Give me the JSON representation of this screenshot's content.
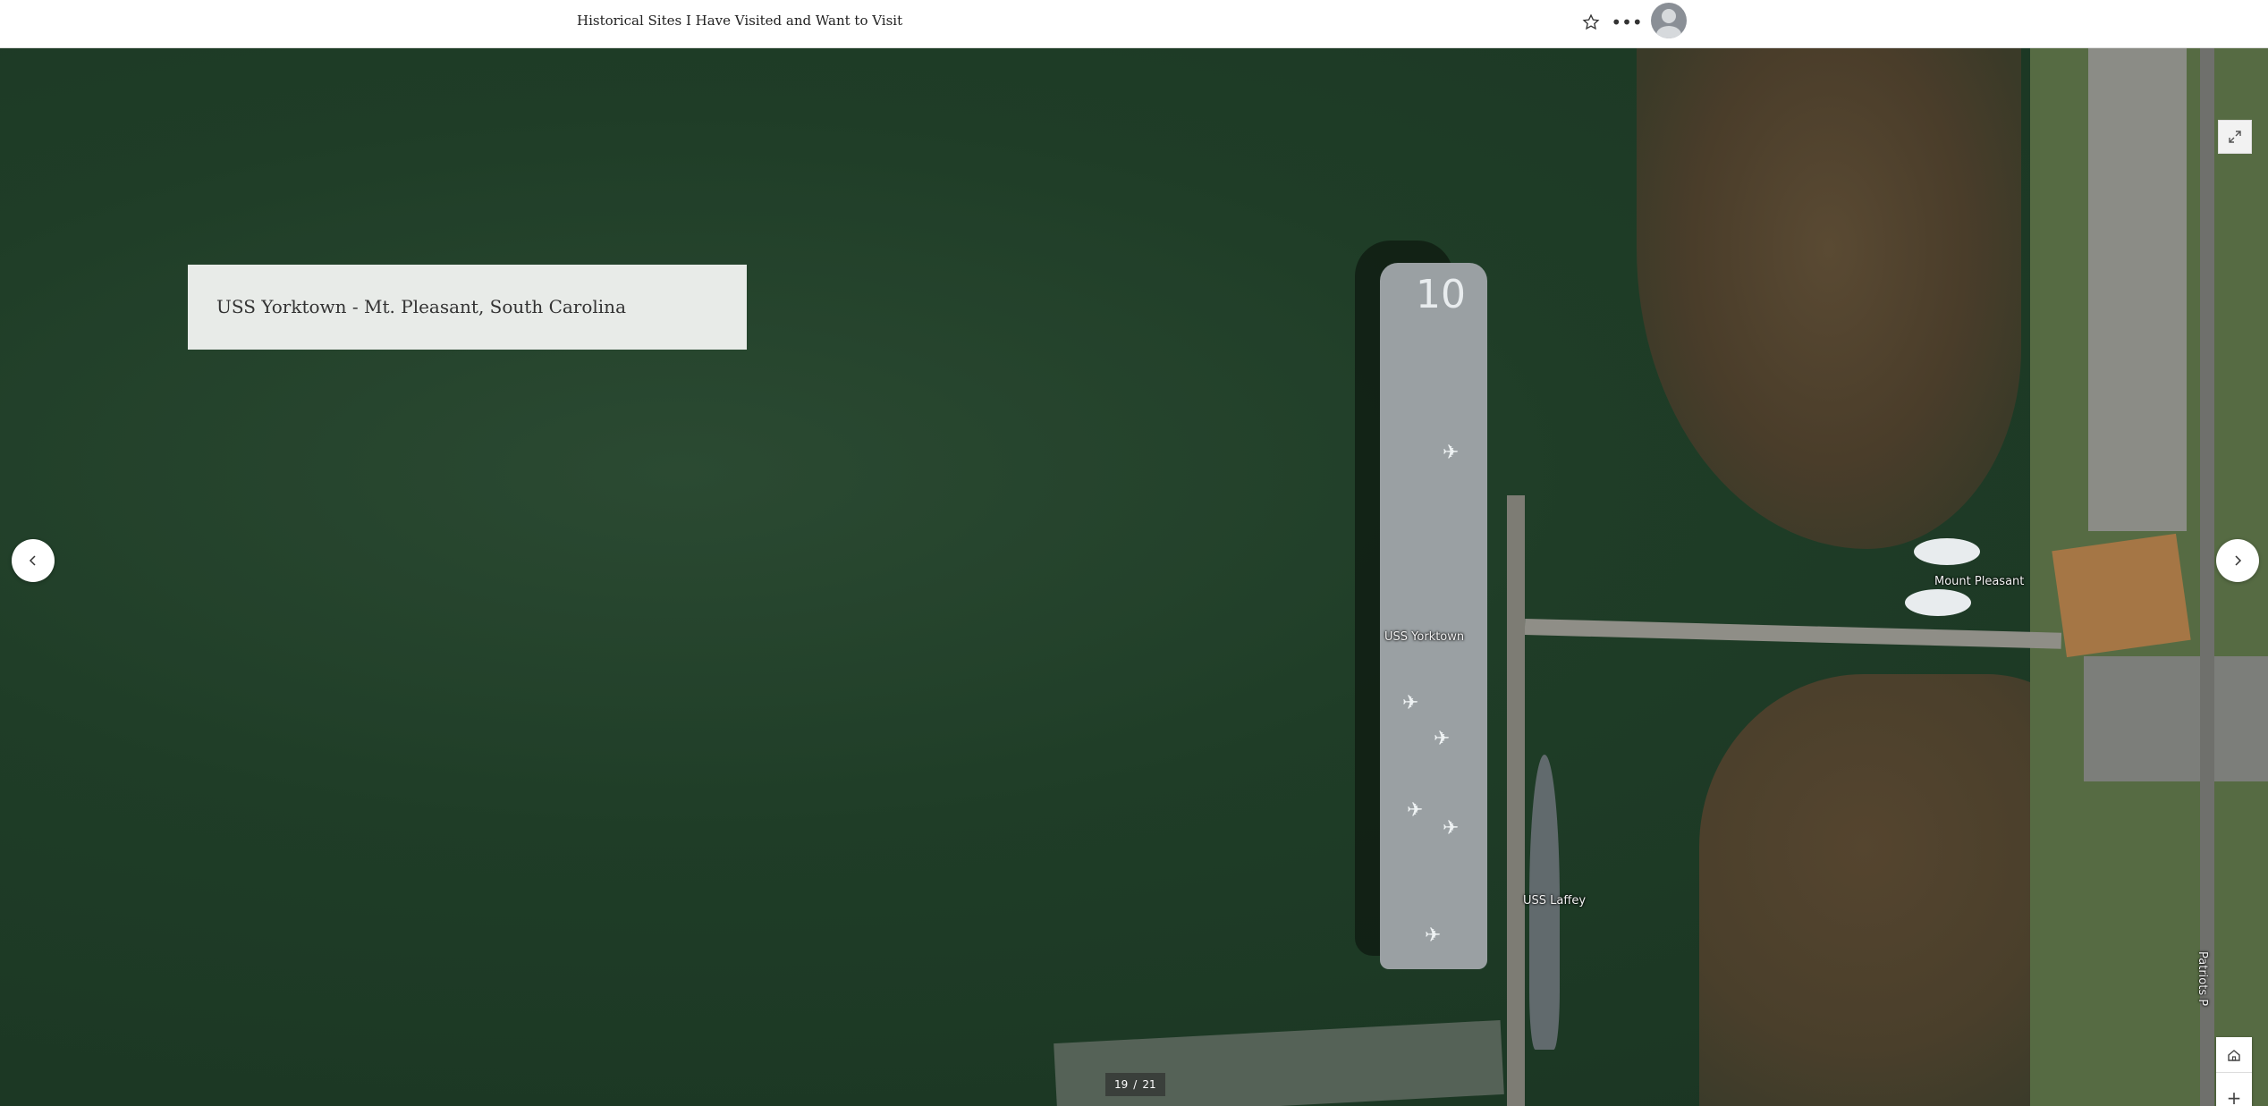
{
  "header": {
    "title": "Historical Sites I Have Visited and Want to Visit",
    "favorite_icon": "star-icon",
    "more_icon": "more-options-icon",
    "avatar_icon": "user-avatar-icon"
  },
  "caption": {
    "text": "USS Yorktown - Mt. Pleasant, South Carolina"
  },
  "map_labels": {
    "yorktown": "USS Yorktown",
    "mount_pleasant": "Mount Pleasant",
    "laffey": "USS Laffey",
    "patriots": "Patriots P"
  },
  "carrier_number": "10",
  "navigation": {
    "prev_icon": "chevron-left-icon",
    "next_icon": "chevron-right-icon"
  },
  "map_controls": {
    "expand_icon": "expand-icon",
    "home_icon": "home-icon",
    "zoom_in": "+",
    "zoom_out": "−"
  },
  "slide_counter": {
    "current": "19",
    "separator": "/",
    "total": "21"
  },
  "colors": {
    "water": "#1f3d27",
    "caption_bg": "#e8ebe8"
  }
}
